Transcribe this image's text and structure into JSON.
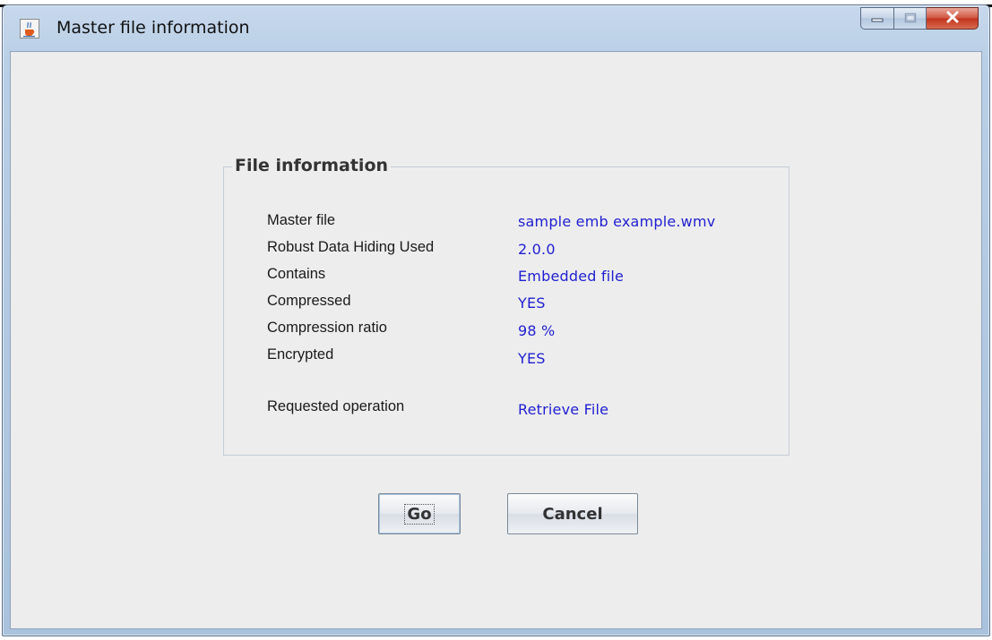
{
  "window": {
    "title": "Master file information"
  },
  "group": {
    "title": "File information",
    "rows": [
      {
        "label": "Master file",
        "value": "sample emb example.wmv"
      },
      {
        "label": "Robust Data Hiding Used",
        "value": "2.0.0"
      },
      {
        "label": "Contains",
        "value": "Embedded file"
      },
      {
        "label": "Compressed",
        "value": "YES"
      },
      {
        "label": "Compression ratio",
        "value": "98 %"
      },
      {
        "label": "Encrypted",
        "value": "YES"
      },
      {
        "label": "Requested operation",
        "value": "Retrieve File"
      }
    ]
  },
  "buttons": {
    "go": "Go",
    "cancel": "Cancel"
  },
  "icons": {
    "app": "java-cup-icon",
    "minimize": "minimize-icon",
    "maximize": "maximize-icon",
    "close": "close-icon"
  },
  "colors": {
    "value_text": "#1f1fd1",
    "close_button": "#c2321c"
  }
}
